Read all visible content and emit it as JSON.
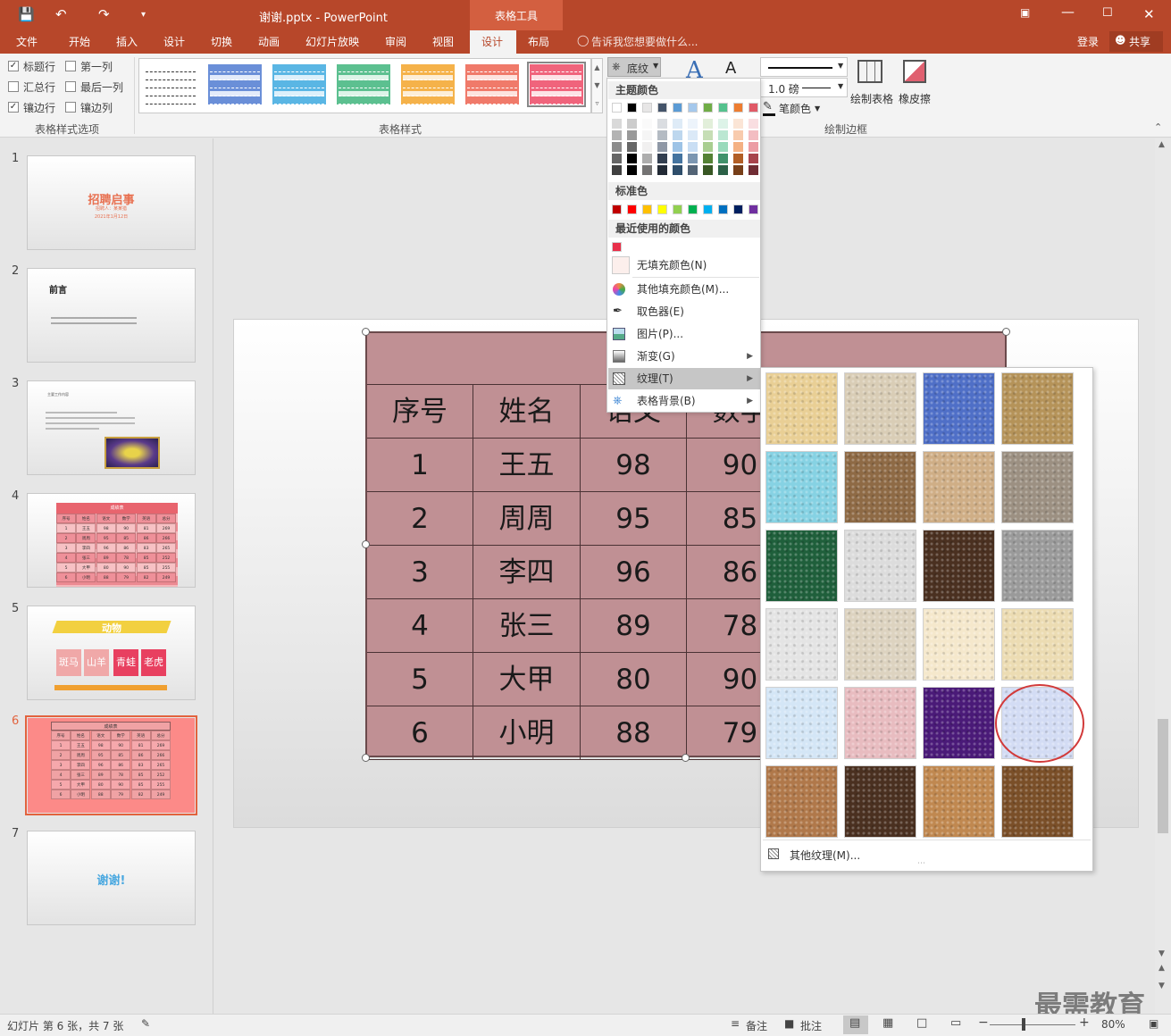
{
  "window": {
    "title": "谢谢.pptx - PowerPoint",
    "context_tab": "表格工具",
    "login": "登录",
    "share": "共享"
  },
  "tabs": [
    "文件",
    "开始",
    "插入",
    "设计",
    "切换",
    "动画",
    "幻灯片放映",
    "审阅",
    "视图",
    "设计",
    "布局"
  ],
  "tell_me": "告诉我您想要做什么...",
  "ribbon": {
    "options": {
      "header_row": "标题行",
      "first_col": "第一列",
      "total_row": "汇总行",
      "last_col": "最后一列",
      "banded_rows": "镶边行",
      "banded_cols": "镶边列",
      "group_label": "表格样式选项"
    },
    "styles_label": "表格样式",
    "shading_btn": "底纹",
    "pen_weight": "1.0 磅",
    "pen_color": "笔颜色",
    "draw_table": "绘制表格",
    "eraser": "橡皮擦",
    "draw_borders_label": "绘制边框"
  },
  "slide_numbers": [
    "1",
    "2",
    "3",
    "4",
    "5",
    "6",
    "7"
  ],
  "thumbs": {
    "t1_title": "招聘启事",
    "t1_sub": "招聘人：某某猎",
    "t1_date": "2021年1月12日",
    "t2_title": "前言",
    "t3_text": "主要工作内容",
    "t4_title": "成绩表",
    "t5_title": "动物",
    "t5_cells": [
      "斑马",
      "山羊",
      "青蛙",
      "老虎"
    ],
    "t6_title": "成绩表",
    "t7_title": "谢谢!"
  },
  "table": {
    "headers": [
      "序号",
      "姓名",
      "语文",
      "数学"
    ],
    "rows": [
      [
        "1",
        "王五",
        "98",
        "90"
      ],
      [
        "2",
        "周周",
        "95",
        "85"
      ],
      [
        "3",
        "李四",
        "96",
        "86"
      ],
      [
        "4",
        "张三",
        "89",
        "78"
      ],
      [
        "5",
        "大甲",
        "80",
        "90"
      ],
      [
        "6",
        "小明",
        "88",
        "79"
      ]
    ]
  },
  "mini_table": {
    "headers": [
      "序号",
      "姓名",
      "语文",
      "数学",
      "英语",
      "总分"
    ],
    "rows": [
      [
        "1",
        "王五",
        "98",
        "90",
        "81",
        "269"
      ],
      [
        "2",
        "周周",
        "95",
        "85",
        "86",
        "266"
      ],
      [
        "3",
        "李四",
        "96",
        "86",
        "83",
        "265"
      ],
      [
        "4",
        "张三",
        "89",
        "78",
        "85",
        "252"
      ],
      [
        "5",
        "大甲",
        "80",
        "90",
        "85",
        "255"
      ],
      [
        "6",
        "小明",
        "88",
        "79",
        "82",
        "249"
      ]
    ]
  },
  "color_menu": {
    "theme_colors": "主题颜色",
    "standard_colors": "标准色",
    "recent_colors": "最近使用的颜色",
    "no_fill": "无填充颜色(N)",
    "more_colors": "其他填充颜色(M)...",
    "eyedropper": "取色器(E)",
    "picture": "图片(P)...",
    "gradient": "渐变(G)",
    "texture": "纹理(T)",
    "table_bg": "表格背景(B)",
    "theme_top": [
      "#ffffff",
      "#000000",
      "#e7e6e6",
      "#44546a",
      "#5b9bd5",
      "#a5c8ec",
      "#70ad47",
      "#55c28e",
      "#ed7d31",
      "#e05a67"
    ],
    "standard": [
      "#c00000",
      "#ff0000",
      "#ffc000",
      "#ffff00",
      "#92d050",
      "#00b050",
      "#00b0f0",
      "#0070c0",
      "#002060",
      "#7030a0"
    ],
    "recent": [
      "#e8304a"
    ]
  },
  "texture_menu": {
    "more": "其他纹理(M)...",
    "textures": [
      "#e9cf95",
      "#d9cdb6",
      "#4f6fc7",
      "#b59359",
      "#86d2e3",
      "#8e6a45",
      "#cfae86",
      "#9c9082",
      "#1f5f3b",
      "#dcdcdc",
      "#4a3020",
      "#9a9a9a",
      "#e4e4e4",
      "#ddd3c0",
      "#f5e8cc",
      "#ecdcb3",
      "#d4e6f6",
      "#e8bcc0",
      "#4a1a78",
      "#d3dcf4",
      "#b0784a",
      "#4a3020",
      "#c08850",
      "#7a4f28"
    ]
  },
  "status": {
    "slide_info": "幻灯片 第 6 张，共 7 张",
    "notes": "备注",
    "comments": "批注",
    "zoom": "80%"
  },
  "watermark": "最需教育"
}
